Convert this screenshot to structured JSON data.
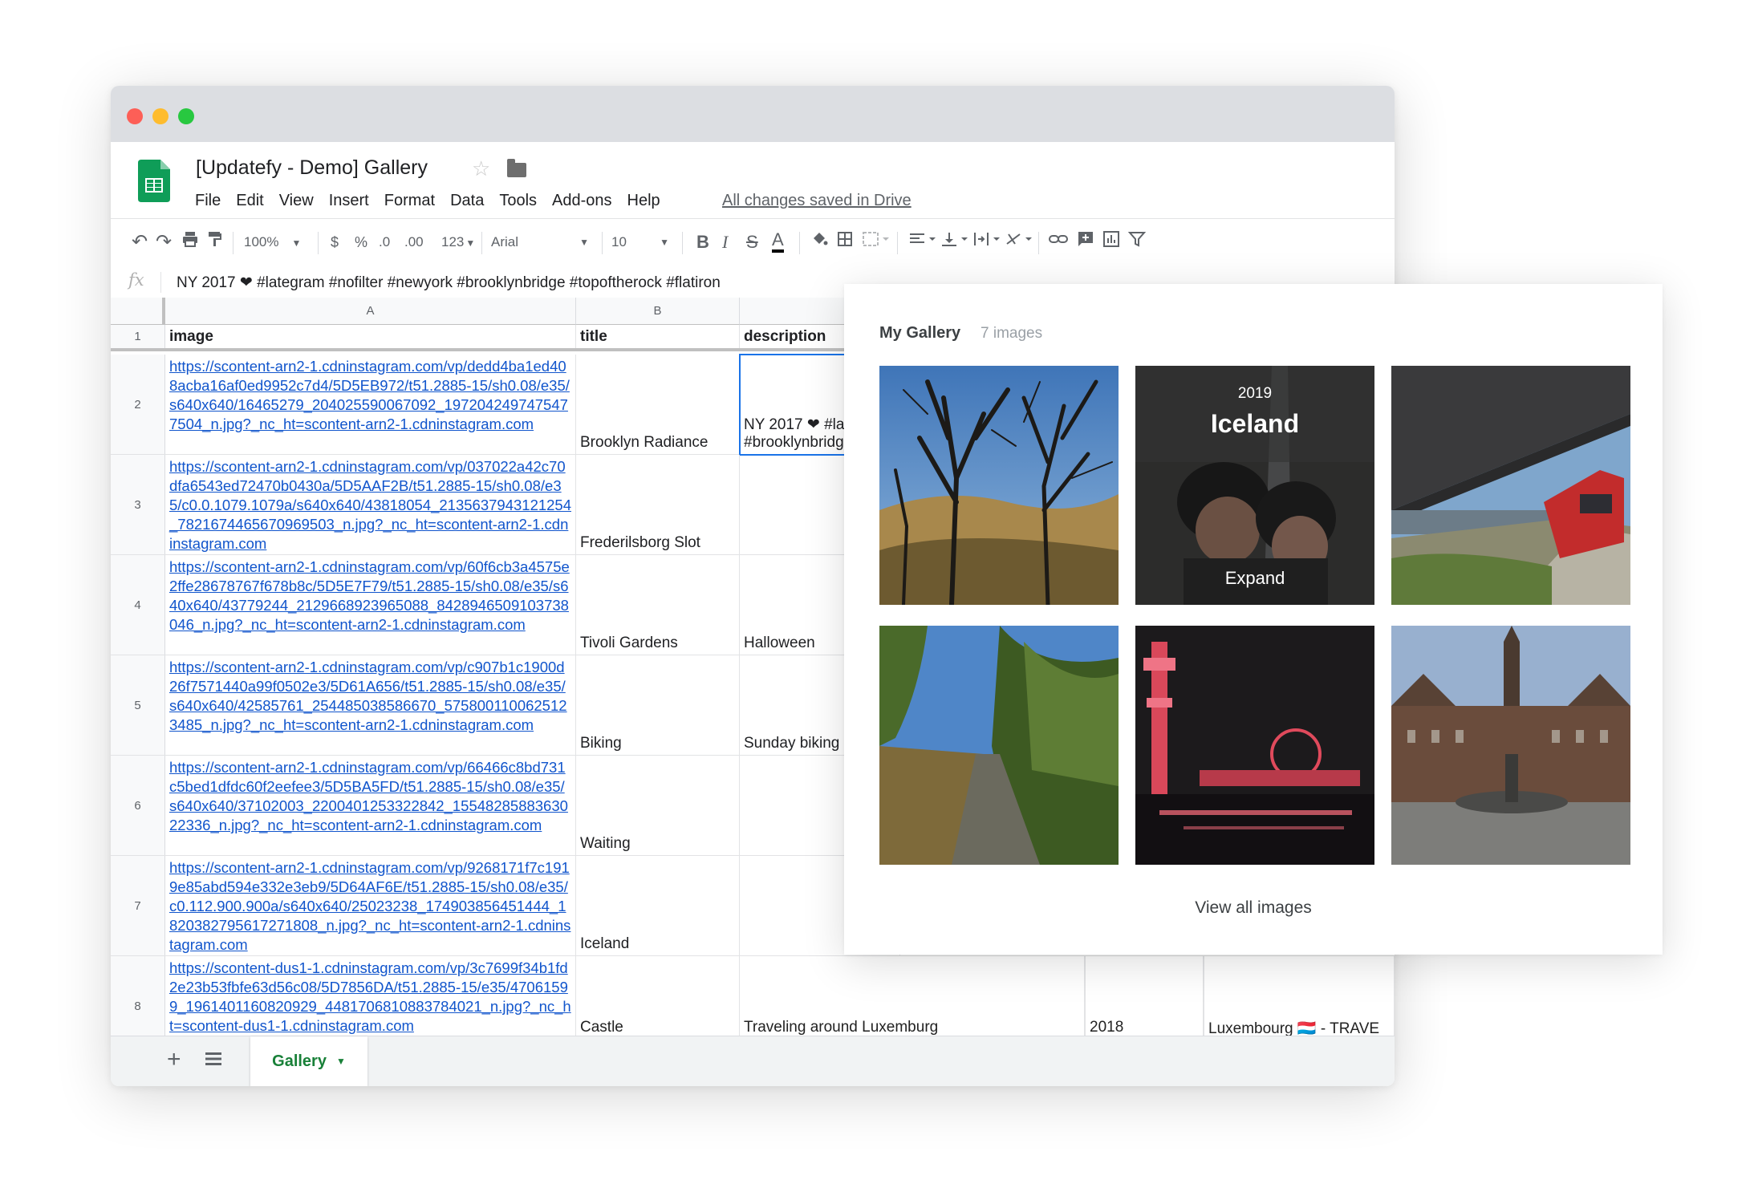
{
  "app": {
    "doc_title": "[Updatefy - Demo] Gallery",
    "menu": [
      "File",
      "Edit",
      "View",
      "Insert",
      "Format",
      "Data",
      "Tools",
      "Add-ons",
      "Help"
    ],
    "save_status": "All changes saved in Drive"
  },
  "toolbar": {
    "zoom": "100%",
    "currency": "$",
    "percent": "%",
    "dec_decrease": ".0",
    "dec_increase": ".00",
    "more_formats": "123",
    "font": "Arial",
    "font_size": "10"
  },
  "formula_bar": {
    "fx": "fx",
    "content": "NY 2017 ❤ #lategram #nofilter #newyork #brooklynbridge #topoftherock #flatiron"
  },
  "grid": {
    "columns": [
      "A",
      "B"
    ],
    "header_row": {
      "num": "1",
      "image": "image",
      "title": "title",
      "description": "description"
    },
    "rows": [
      {
        "num": "2",
        "image": "https://scontent-arn2-1.cdninstagram.com/vp/dedd4ba1ed408acba16af0ed9952c7d4/5D5EB972/t51.2885-15/sh0.08/e35/s640x640/16465279_204025590067092_1972042497475477504_n.jpg?_nc_ht=scontent-arn2-1.cdninstagram.com",
        "title": "Brooklyn Radiance",
        "description_l1": "NY 2017 ❤ #la",
        "description_l2": "#brooklynbridg"
      },
      {
        "num": "3",
        "image": "https://scontent-arn2-1.cdninstagram.com/vp/037022a42c70dfa6543ed72470b0430a/5D5AAF2B/t51.2885-15/sh0.08/e35/c0.0.1079.1079a/s640x640/43818054_2135637943121254_7821674465670969503_n.jpg?_nc_ht=scontent-arn2-1.cdninstagram.com",
        "title": "Frederilsborg Slot",
        "description": ""
      },
      {
        "num": "4",
        "image": "https://scontent-arn2-1.cdninstagram.com/vp/60f6cb3a4575e2ffe28678767f678b8c/5D5E7F79/t51.2885-15/sh0.08/e35/s640x640/43779244_2129668923965088_8428946509103738046_n.jpg?_nc_ht=scontent-arn2-1.cdninstagram.com",
        "title": "Tivoli Gardens",
        "description": "Halloween"
      },
      {
        "num": "5",
        "image": "https://scontent-arn2-1.cdninstagram.com/vp/c907b1c1900d26f7571440a99f0502e3/5D61A656/t51.2885-15/sh0.08/e35/s640x640/42585761_254485038586670_5758001100625123485_n.jpg?_nc_ht=scontent-arn2-1.cdninstagram.com",
        "title": "Biking",
        "description": "Sunday biking"
      },
      {
        "num": "6",
        "image": "https://scontent-arn2-1.cdninstagram.com/vp/66466c8bd731c5bed1dfdc60f2eefee3/5D5BA5FD/t51.2885-15/sh0.08/e35/s640x640/37102003_2200401253322842_1554828588363022336_n.jpg?_nc_ht=scontent-arn2-1.cdninstagram.com",
        "title": "Waiting",
        "description": ""
      },
      {
        "num": "7",
        "image": "https://scontent-arn2-1.cdninstagram.com/vp/9268171f7c1919e85abd594e332e3eb9/5D64AF6E/t51.2885-15/sh0.08/e35/c0.112.900.900a/s640x640/25023238_174903856451444_1820382795617271808_n.jpg?_nc_ht=scontent-arn2-1.cdninstagram.com",
        "title": "Iceland",
        "description": ""
      },
      {
        "num": "8",
        "image": "https://scontent-dus1-1.cdninstagram.com/vp/3c7699f34b1fd2e23b53fbfe63d56c08/5D7856DA/t51.2885-15/e35/47061599_1961401160820929_4481706810883784021_n.jpg?_nc_ht=scontent-dus1-1.cdninstagram.com",
        "title": "Castle",
        "description": "Traveling around Luxemburg",
        "year": "2018",
        "extra": "Luxembourg 🇱🇺 - TRAVE"
      }
    ]
  },
  "sheet_tabs": {
    "active": "Gallery"
  },
  "gallery": {
    "title": "My Gallery",
    "count": "7 images",
    "featured": {
      "year": "2019",
      "title": "Iceland",
      "action": "Expand"
    },
    "view_all": "View all images",
    "images": [
      "bare-trees",
      "iceland-selfie",
      "train-station",
      "forest-path",
      "tivoli-night",
      "frederiksborg-castle"
    ]
  },
  "colors": {
    "link": "#1155cc",
    "sheet_tab_green": "#188038",
    "selection": "#1a73e8",
    "sheets_logo": "#0f9d58"
  }
}
